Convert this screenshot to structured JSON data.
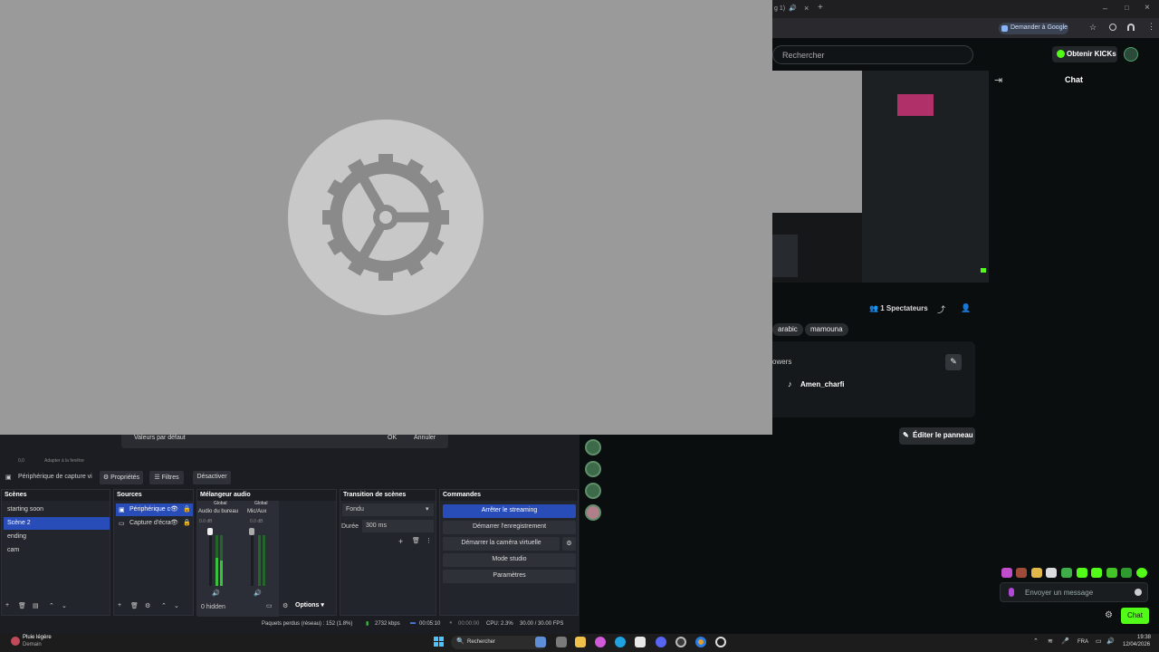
{
  "browser": {
    "search_placeholder": "Rechercher",
    "google_button": "Demander à Google",
    "get_kicks": "Obtenir KICKs",
    "tab_fragment": "g 1)"
  },
  "chat": {
    "title": "Chat",
    "input_placeholder": "Envoyer un message",
    "send_button": "Chat"
  },
  "stream_info": {
    "viewers": "1 Spectateurs",
    "tags": [
      "arabic",
      "mamouna"
    ],
    "about_heading": "owers",
    "social_handle": "Amen_charfi",
    "edit_panel": "Éditer le panneau"
  },
  "dialog": {
    "defaults_button": "Valeurs par défaut",
    "ok_button": "OK",
    "cancel_button": "Annuler"
  },
  "obs": {
    "toolbar_fragments": [
      "0,0",
      "Adapter à la fenêtre"
    ],
    "source_label": "Périphérique de capture vi",
    "properties": "Propriétés",
    "filters": "Filtres",
    "deactivate": "Désactiver",
    "scenes": {
      "title": "Scènes",
      "items": [
        "starting soon",
        "Scène 2",
        "ending",
        "cam"
      ],
      "selected": 1
    },
    "sources": {
      "title": "Sources",
      "items": [
        "Périphérique c",
        "Capture d'écra"
      ]
    },
    "mixer": {
      "title": "Mélangeur audio",
      "channels": [
        {
          "global": "Global",
          "name": "Audio du bureau",
          "db": "0.0 dB"
        },
        {
          "global": "Global",
          "name": "Mic/Aux",
          "db": "0.0 dB"
        }
      ],
      "hidden": "0 hidden",
      "options": "Options"
    },
    "transitions": {
      "title": "Transition de scènes",
      "type": "Fondu",
      "duration_label": "Durée",
      "duration_value": "300 ms"
    },
    "controls": {
      "title": "Commandes",
      "buttons": [
        "Arrêter le streaming",
        "Démarrer l'enregistrement",
        "Démarrer la caméra virtuelle",
        "Mode studio",
        "Paramètres"
      ]
    },
    "status": {
      "dropped": "Paquets perdus (réseau) : 152 (1.8%)",
      "bitrate": "2732 kbps",
      "stream_time": "00:05:10",
      "rec_time": "00:00:00",
      "cpu": "CPU: 2.3%",
      "fps": "30.00 / 30.00 FPS"
    }
  },
  "taskbar": {
    "weather_title": "Pluie légère",
    "weather_sub": "Demain",
    "search": "Rechercher",
    "lang": "FRA",
    "time": "19:38",
    "date": "12/04/2026"
  },
  "colors": {
    "kick_green": "#53fc18",
    "obs_blue": "#284cb8",
    "overlay_grey": "#9a9a9a"
  }
}
